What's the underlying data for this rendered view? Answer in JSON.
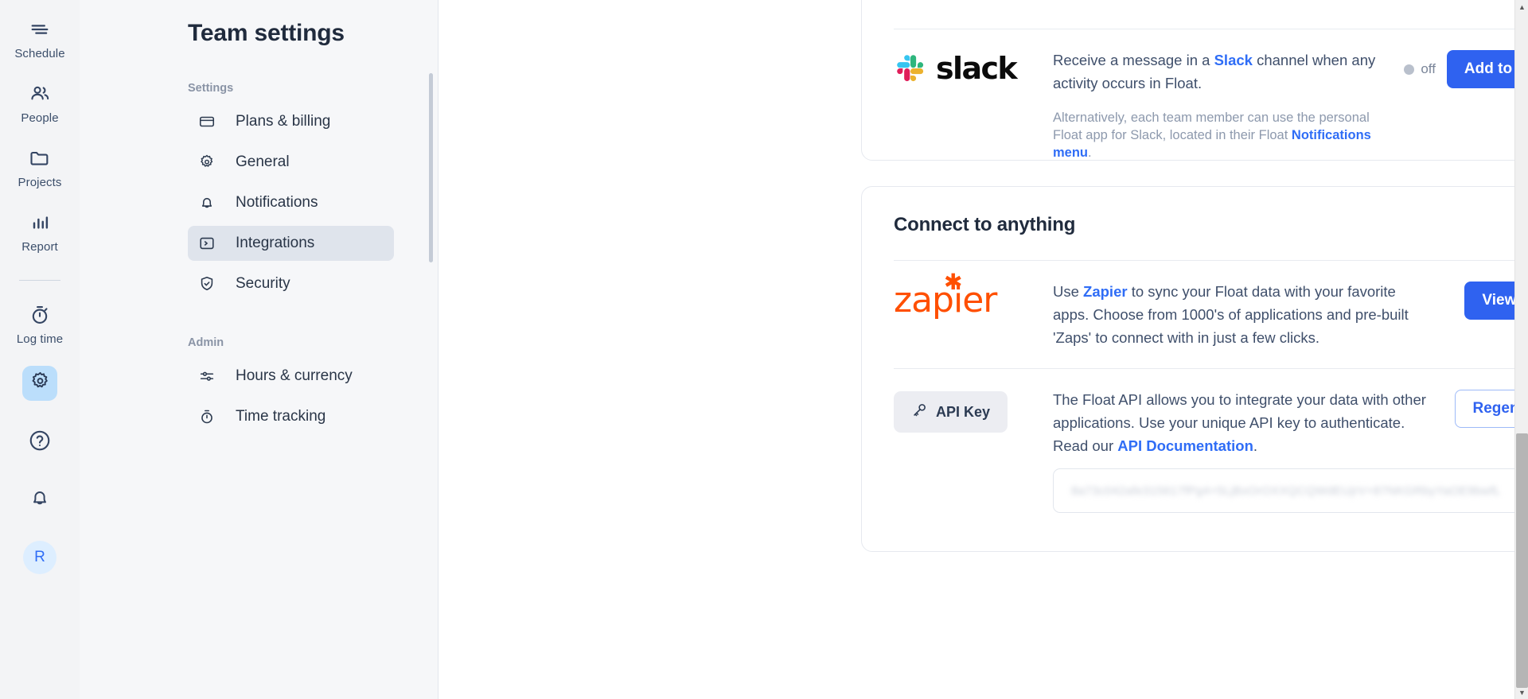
{
  "rail": {
    "items": [
      {
        "label": "Schedule",
        "icon": "schedule-icon"
      },
      {
        "label": "People",
        "icon": "people-icon"
      },
      {
        "label": "Projects",
        "icon": "projects-folder-icon"
      },
      {
        "label": "Report",
        "icon": "report-bars-icon"
      },
      {
        "label": "Log time",
        "icon": "stopwatch-icon"
      }
    ],
    "gear_icon": "gear-icon",
    "help_icon": "help-circle-icon",
    "bell_icon": "bell-icon",
    "avatar_initial": "R"
  },
  "settings": {
    "title": "Team settings",
    "groups": [
      {
        "label": "Settings",
        "items": [
          {
            "label": "Plans & billing",
            "icon": "credit-card-icon",
            "active": false
          },
          {
            "label": "General",
            "icon": "gear-icon",
            "active": false
          },
          {
            "label": "Notifications",
            "icon": "bell-icon",
            "active": false
          },
          {
            "label": "Integrations",
            "icon": "terminal-icon",
            "active": true
          },
          {
            "label": "Security",
            "icon": "shield-check-icon",
            "active": false
          }
        ]
      },
      {
        "label": "Admin",
        "items": [
          {
            "label": "Hours & currency",
            "icon": "sliders-icon",
            "active": false
          },
          {
            "label": "Time tracking",
            "icon": "stopwatch-icon",
            "active": false
          }
        ]
      }
    ]
  },
  "slack_card": {
    "logo_word": "slack",
    "desc_prefix": "Receive a message in a ",
    "desc_link": "Slack",
    "desc_suffix": " channel when any activity occurs in Float.",
    "alt_prefix": "Alternatively, each team member can use the personal Float app for Slack, located in their Float ",
    "alt_link": "Notifications menu",
    "alt_suffix": ".",
    "toggle_state": "off",
    "button_label": "Add to Slack"
  },
  "connect_card": {
    "title": "Connect to anything",
    "zapier": {
      "logo_word": "zapier",
      "desc_prefix": "Use ",
      "desc_link": "Zapier",
      "desc_suffix": " to sync your Float data with your favorite apps. Choose from 1000's of applications and pre-built 'Zaps' to connect with in just a few clicks.",
      "button_label": "View Zaps"
    },
    "api": {
      "chip_label": "API Key",
      "chip_icon": "key-icon",
      "desc_prefix": "The Float API allows you to integrate your data with other applications. Use your unique API key to authenticate. Read our ",
      "desc_link": "API Documentation",
      "desc_suffix": ".",
      "button_label": "Regenerate",
      "key_value": "8a73c042afe315617fPg4+5LjBxOrOXXQCQWdEUjrV+87NKGRbyYaOE9bwfL",
      "copy_icon": "copy-icon"
    }
  },
  "colors": {
    "accent_blue": "#2f62f6",
    "rail_bg": "#f3f4f6",
    "settings_bg": "#f6f7f9",
    "active_nav": "#dfe4ec",
    "highlight_red": "#ff0000",
    "zapier_orange": "#ff4f00"
  }
}
